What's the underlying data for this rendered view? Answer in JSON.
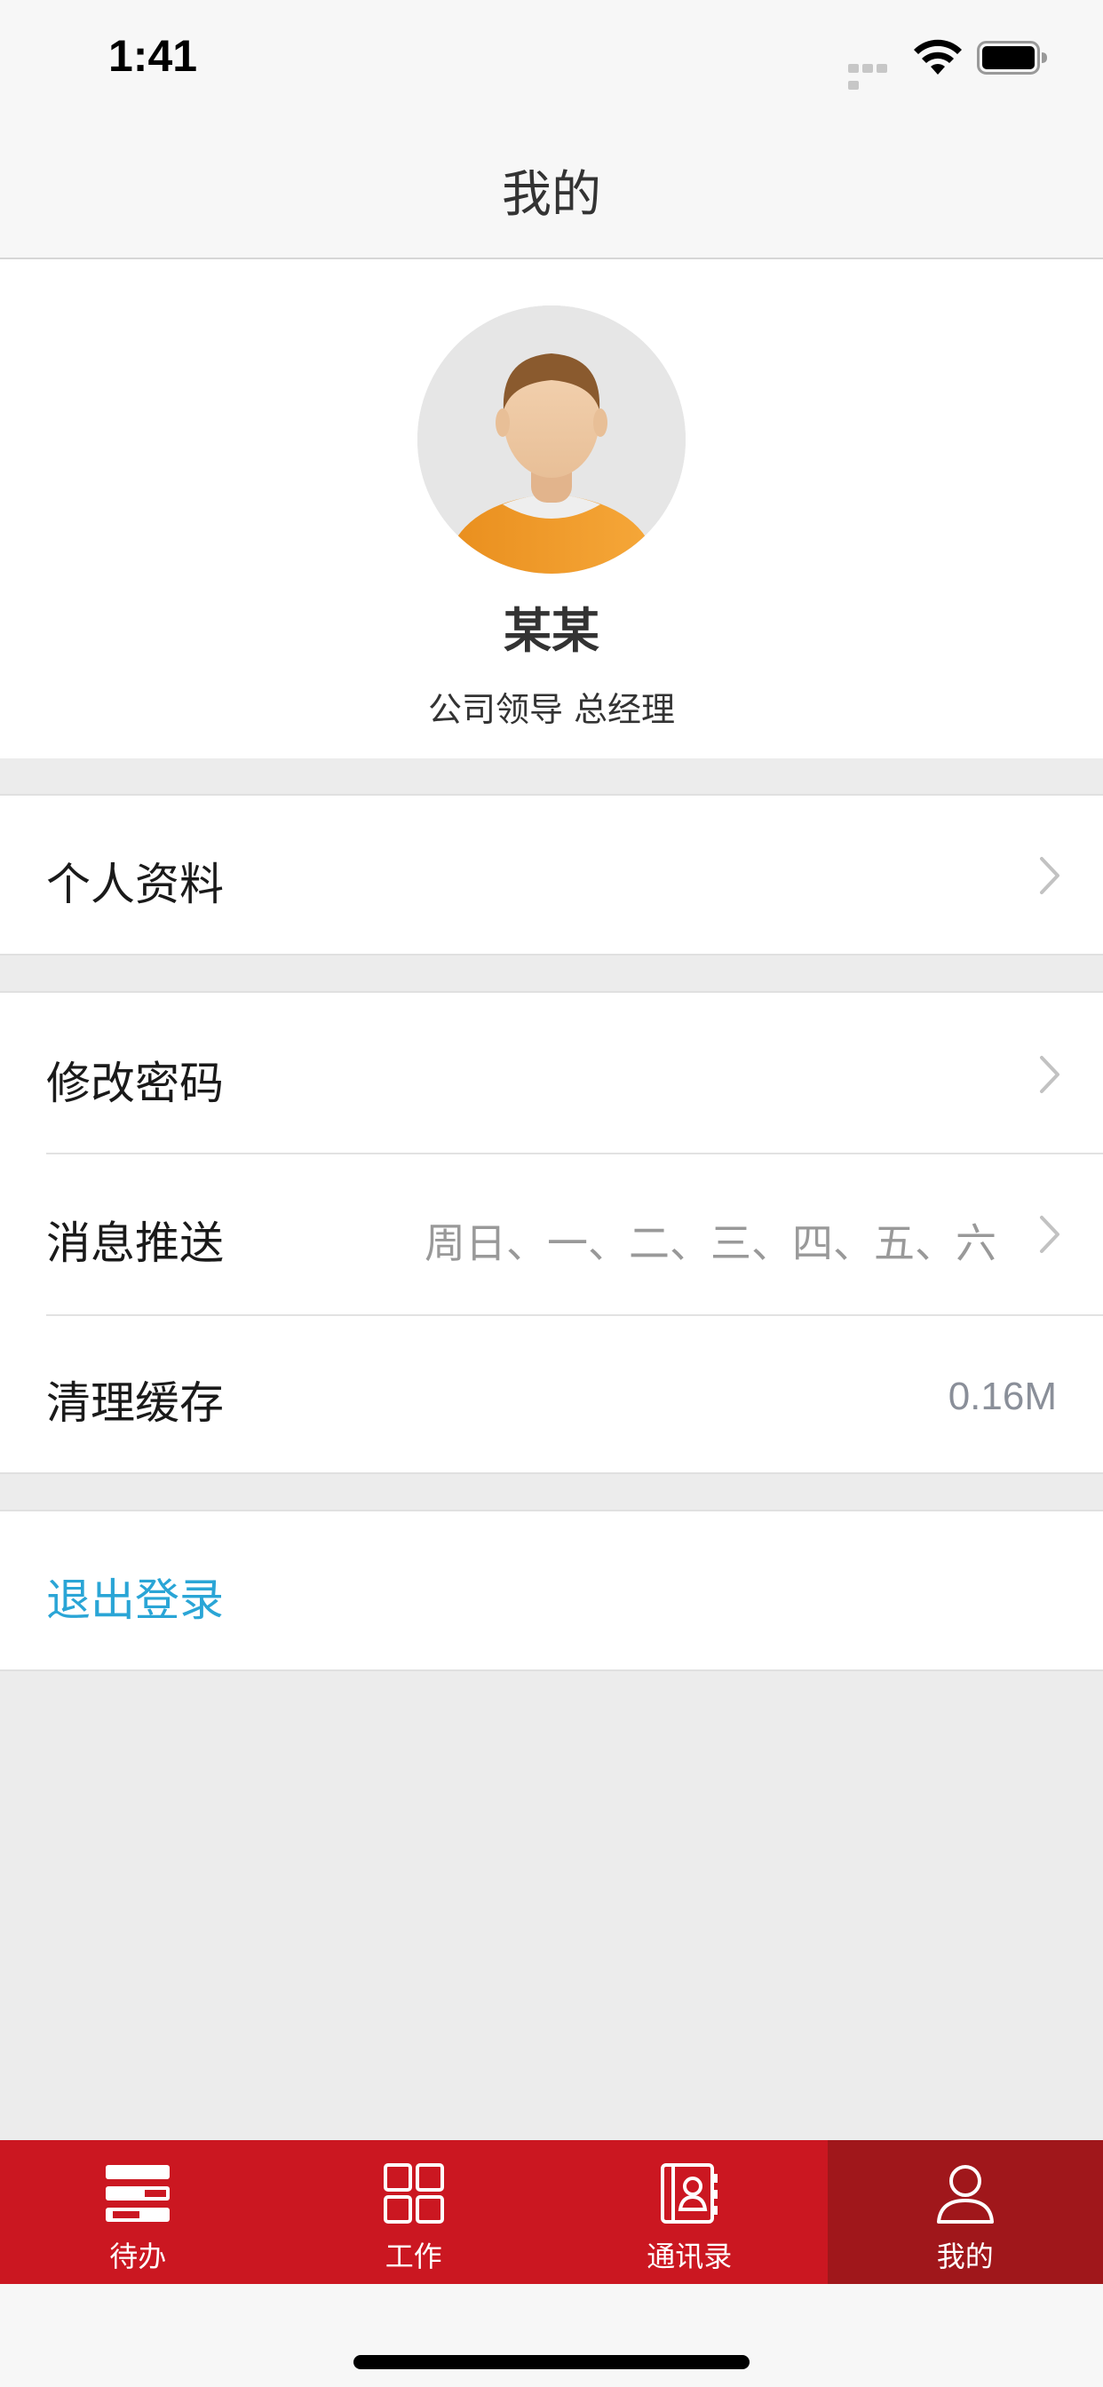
{
  "status_bar": {
    "time": "1:41"
  },
  "header": {
    "title": "我的"
  },
  "profile": {
    "name": "某某",
    "role": "公司领导 总经理"
  },
  "menu": {
    "personal_info": {
      "label": "个人资料"
    },
    "change_password": {
      "label": "修改密码"
    },
    "push_messages": {
      "label": "消息推送",
      "value": "周日、一、二、三、四、五、六"
    },
    "clear_cache": {
      "label": "清理缓存",
      "value": "0.16M"
    },
    "logout": {
      "label": "退出登录"
    }
  },
  "tabs": [
    {
      "label": "待办",
      "icon": "todo-list-icon"
    },
    {
      "label": "工作",
      "icon": "grid-icon"
    },
    {
      "label": "通讯录",
      "icon": "contacts-icon"
    },
    {
      "label": "我的",
      "icon": "person-icon"
    }
  ],
  "colors": {
    "tab_bar": "#cb1721",
    "tab_active": "#a0171b",
    "logout": "#2aa5d6",
    "page_background": "#ececec"
  }
}
